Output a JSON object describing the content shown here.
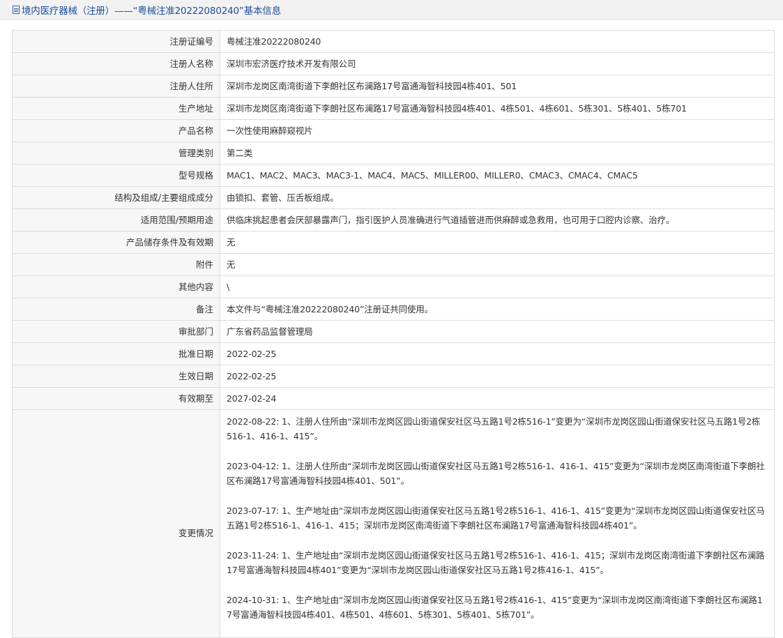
{
  "page": {
    "title": "境内医疗器械（注册）——“粤械注准20222080240”基本信息"
  },
  "rows": [
    {
      "label": "注册证编号",
      "value": "粤械注准20222080240"
    },
    {
      "label": "注册人名称",
      "value": "深圳市宏济医疗技术开发有限公司"
    },
    {
      "label": "注册人住所",
      "value": "深圳市龙岗区南湾街道下李朗社区布澜路17号富通海智科技园4栋401、501"
    },
    {
      "label": "生产地址",
      "value": "深圳市龙岗区南湾街道下李朗社区布澜路17号富通海智科技园4栋401、4栋501、4栋601、5栋301、5栋401、5栋701"
    },
    {
      "label": "产品名称",
      "value": "一次性使用麻醉窥视片"
    },
    {
      "label": "管理类别",
      "value": "第二类"
    },
    {
      "label": "型号规格",
      "value": "MAC1、MAC2、MAC3、MAC3-1、MAC4、MAC5、MILLER00、MILLER0、CMAC3、CMAC4、CMAC5"
    },
    {
      "label": "结构及组成/主要组成成分",
      "value": "由锁扣、套管、压舌板组成。"
    },
    {
      "label": "适用范围/预期用途",
      "value": "供临床挑起患者会厌部暴露声门，指引医护人员准确进行气道插管进而供麻醉或急救用，也可用于口腔内诊察、治疗。"
    },
    {
      "label": "产品储存条件及有效期",
      "value": "无"
    },
    {
      "label": "附件",
      "value": "无"
    },
    {
      "label": "其他内容",
      "value": "\\"
    },
    {
      "label": "备注",
      "value": "本文件与“粤械注准20222080240”注册证共同使用。"
    },
    {
      "label": "审批部门",
      "value": "广东省药品监督管理局"
    },
    {
      "label": "批准日期",
      "value": "2022-02-25"
    },
    {
      "label": "生效日期",
      "value": "2022-02-25"
    },
    {
      "label": "有效期至",
      "value": "2027-02-24"
    }
  ],
  "changes": {
    "label": "变更情况",
    "items": [
      "2022-08-22: 1、注册人住所由“深圳市龙岗区园山街道保安社区马五路1号2栋516-1”变更为“深圳市龙岗区园山街道保安社区马五路1号2栋516-1、416-1、415”。",
      "2023-04-12: 1、注册人住所由“深圳市龙岗区园山街道保安社区马五路1号2栋516-1、416-1、415”变更为“深圳市龙岗区南湾街道下李朗社区布澜路17号富通海智科技园4栋401、501”。",
      "2023-07-17: 1、生产地址由“深圳市龙岗区园山街道保安社区马五路1号2栋516-1、416-1、415”变更为“深圳市龙岗区园山街道保安社区马五路1号2栋516-1、416-1、415；深圳市龙岗区南湾街道下李朗社区布澜路17号富通海智科技园4栋401”。",
      "2023-11-24: 1、生产地址由“深圳市龙岗区园山街道保安社区马五路1号2栋516-1、416-1、415；深圳市龙岗区南湾街道下李朗社区布澜路17号富通海智科技园4栋401”变更为“深圳市龙岗区园山街道保安社区马五路1号2栋416-1、415”。",
      "2024-10-31: 1、生产地址由“深圳市龙岗区园山街道保安社区马五路1号2栋416-1、415”变更为“深圳市龙岗区南湾街道下李朗社区布澜路17号富通海智科技园4栋401、4栋501、4栋601、5栋301、5栋401、5栋701”。"
    ]
  },
  "colors": {
    "title_text": "#1f4f9c",
    "label_bg": "#f7f7f7",
    "border": "#dcdcdc"
  }
}
